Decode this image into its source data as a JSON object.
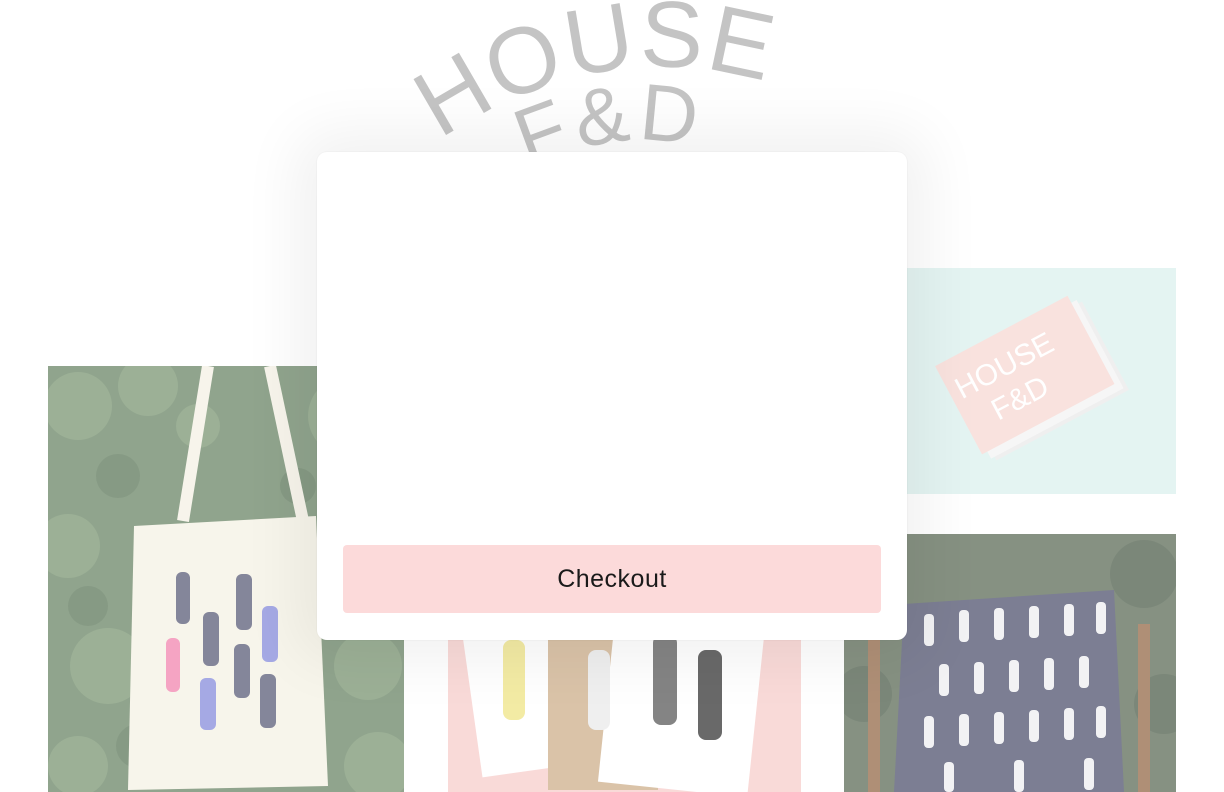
{
  "brand": {
    "logo_line_1": "HOUSE",
    "logo_line_2": "F&D",
    "logo_color": "#a9a9a9"
  },
  "products": [
    {
      "name": "tote-bag",
      "image": "tote bag with hand prints on foliage background"
    },
    {
      "name": "business-cards",
      "image": "stack of House F&D cards on mint background"
    },
    {
      "name": "hand-prints",
      "image": "hand illustration art prints on pink background"
    },
    {
      "name": "hand-pillow",
      "image": "navy pillow with white hand pattern on wooden chair"
    }
  ],
  "cart": {
    "checkout_label": "Checkout",
    "checkout_color": "#fcdada"
  }
}
